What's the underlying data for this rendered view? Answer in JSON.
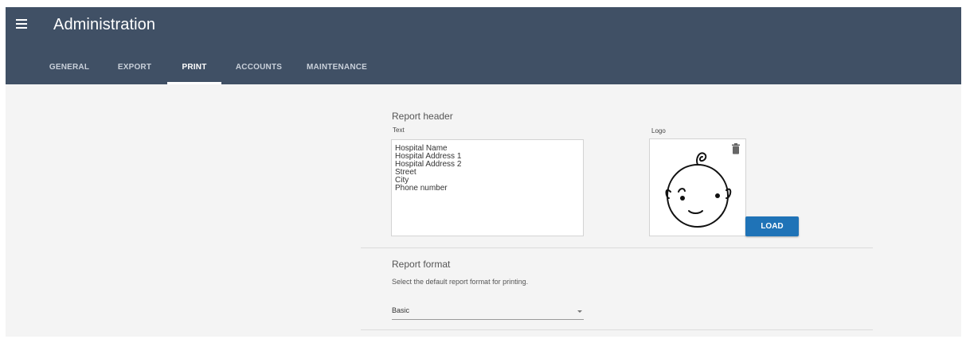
{
  "header": {
    "title": "Administration",
    "menu_icon": "hamburger-menu-icon",
    "background": "#405065"
  },
  "tabs": [
    {
      "label": "GENERAL",
      "active": false
    },
    {
      "label": "EXPORT",
      "active": false
    },
    {
      "label": "PRINT",
      "active": true
    },
    {
      "label": "ACCOUNTS",
      "active": false
    },
    {
      "label": "MAINTENANCE",
      "active": false
    }
  ],
  "report_header": {
    "section_title": "Report header",
    "text_label": "Text",
    "text_lines": [
      "Hospital Name",
      "Hospital Address 1",
      "Hospital Address 2",
      "Street",
      "City",
      "Phone number"
    ],
    "logo_label": "Logo",
    "logo_image": "baby-face-drawing",
    "delete_icon": "trash-icon",
    "load_label": "LOAD",
    "accent": "#1f73b7"
  },
  "report_format": {
    "section_title": "Report format",
    "description": "Select the default report format for printing.",
    "selected": "Basic"
  }
}
